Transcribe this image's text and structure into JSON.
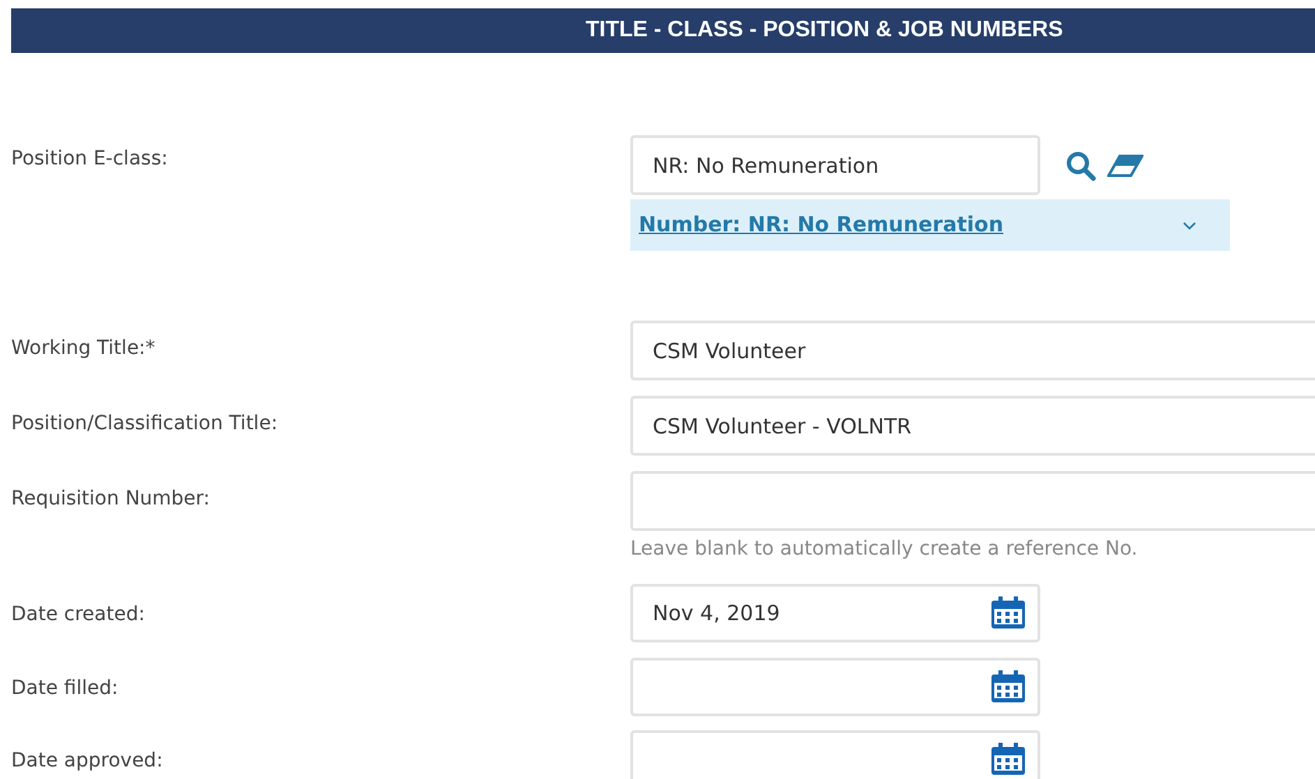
{
  "header": {
    "title": "TITLE - CLASS - POSITION & JOB NUMBERS"
  },
  "fields": [
    {
      "kind": "lookup",
      "label": "Position E-class:",
      "value": "NR: No Remuneration",
      "link": "Number: NR: No Remuneration"
    },
    {
      "kind": "text",
      "label": "Working Title:*",
      "value": "CSM Volunteer"
    },
    {
      "kind": "text",
      "label": "Position/Classification Title:",
      "value": "CSM Volunteer - VOLNTR"
    },
    {
      "kind": "text",
      "label": "Requisition Number:",
      "hint": "Leave blank to automatically create a reference No."
    },
    {
      "kind": "date",
      "label": "Date created:",
      "value": "Nov 4, 2019"
    },
    {
      "kind": "date",
      "label": "Date filled:"
    },
    {
      "kind": "date",
      "label": "Date approved:"
    }
  ]
}
